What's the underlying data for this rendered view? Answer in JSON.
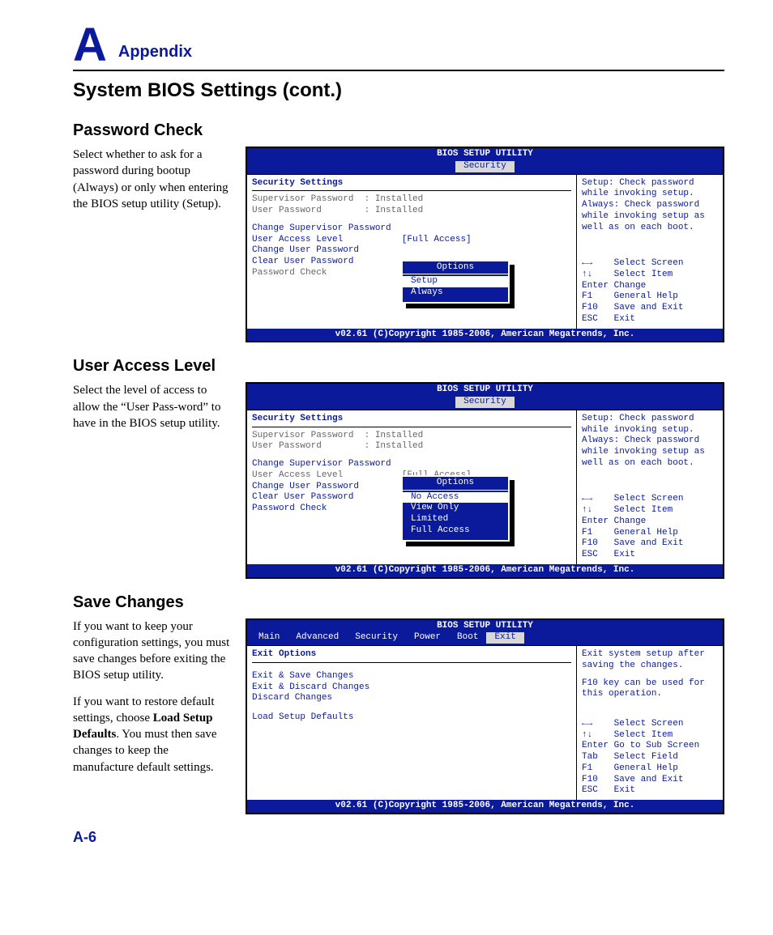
{
  "header": {
    "big": "A",
    "word": "Appendix"
  },
  "title": "System BIOS Settings (cont.)",
  "page_num": "A-6",
  "s1": {
    "heading": "Password Check",
    "body": "Select whether to ask for a password during bootup (Always) or only when entering the BIOS setup utility (Setup).",
    "bios": {
      "title": "BIOS SETUP UTILITY",
      "tab": "Security",
      "pane_title": "Security Settings",
      "sup": "Supervisor Password  : Installed",
      "usr": "User Password        : Installed",
      "m1": "Change Supervisor Password",
      "m2": "User Access Level           [Full Access]",
      "m3": "Change User Password",
      "m4": "Clear User Password",
      "m5": "Password Check",
      "popup_title": "Options",
      "opt1": "Setup",
      "opt2": "Always",
      "help": "Setup: Check password while invoking setup. Always: Check password while invoking setup as well as on each boot.",
      "k1": "←→    Select Screen",
      "k2": "↑↓    Select Item",
      "k3": "Enter Change",
      "k4": "F1    General Help",
      "k5": "F10   Save and Exit",
      "k6": "ESC   Exit",
      "footer": "v02.61 (C)Copyright 1985-2006, American Megatrends, Inc."
    }
  },
  "s2": {
    "heading": "User Access Level",
    "body": "Select the level of access to allow the “User Pass-word” to have in the BIOS setup utility.",
    "bios": {
      "title": "BIOS SETUP UTILITY",
      "tab": "Security",
      "pane_title": "Security Settings",
      "sup": "Supervisor Password  : Installed",
      "usr": "User Password        : Installed",
      "m1": "Change Supervisor Password",
      "m2": "User Access Level           [Full Access]",
      "m3": "Change User Password",
      "m4": "Clear User Password",
      "m5": "Password Check",
      "popup_title": "Options",
      "opt1": "No Access",
      "opt2": "View Only",
      "opt3": "Limited",
      "opt4": "Full Access",
      "help": "Setup: Check password while invoking setup. Always: Check password while invoking setup as well as on each boot.",
      "k1": "←→    Select Screen",
      "k2": "↑↓    Select Item",
      "k3": "Enter Change",
      "k4": "F1    General Help",
      "k5": "F10   Save and Exit",
      "k6": "ESC   Exit",
      "footer": "v02.61 (C)Copyright 1985-2006, American Megatrends, Inc."
    }
  },
  "s3": {
    "heading": "Save Changes",
    "body1": "If you want to keep your configuration settings, you must save changes before exiting the BIOS setup utility.",
    "body2a": "If you want to restore default settings, choose ",
    "body2b": "Load Setup Defaults",
    "body2c": ". You must then save changes to keep the manufacture default settings.",
    "bios": {
      "title": "BIOS SETUP UTILITY",
      "tabs": [
        "Main",
        "Advanced",
        "Security",
        "Power",
        "Boot",
        "Exit"
      ],
      "sel_tab": "Exit",
      "pane_title": "Exit Options",
      "m1": "Exit & Save Changes",
      "m2": "Exit & Discard Changes",
      "m3": "Discard Changes",
      "m4": "Load Setup Defaults",
      "help1": "Exit system setup after saving the changes.",
      "help2": "F10 key can be used for this operation.",
      "k1": "←→    Select Screen",
      "k2": "↑↓    Select Item",
      "k3": "Enter Go to Sub Screen",
      "k4": "Tab   Select Field",
      "k5": "F1    General Help",
      "k6": "F10   Save and Exit",
      "k7": "ESC   Exit",
      "footer": "v02.61 (C)Copyright 1985-2006, American Megatrends, Inc."
    }
  }
}
